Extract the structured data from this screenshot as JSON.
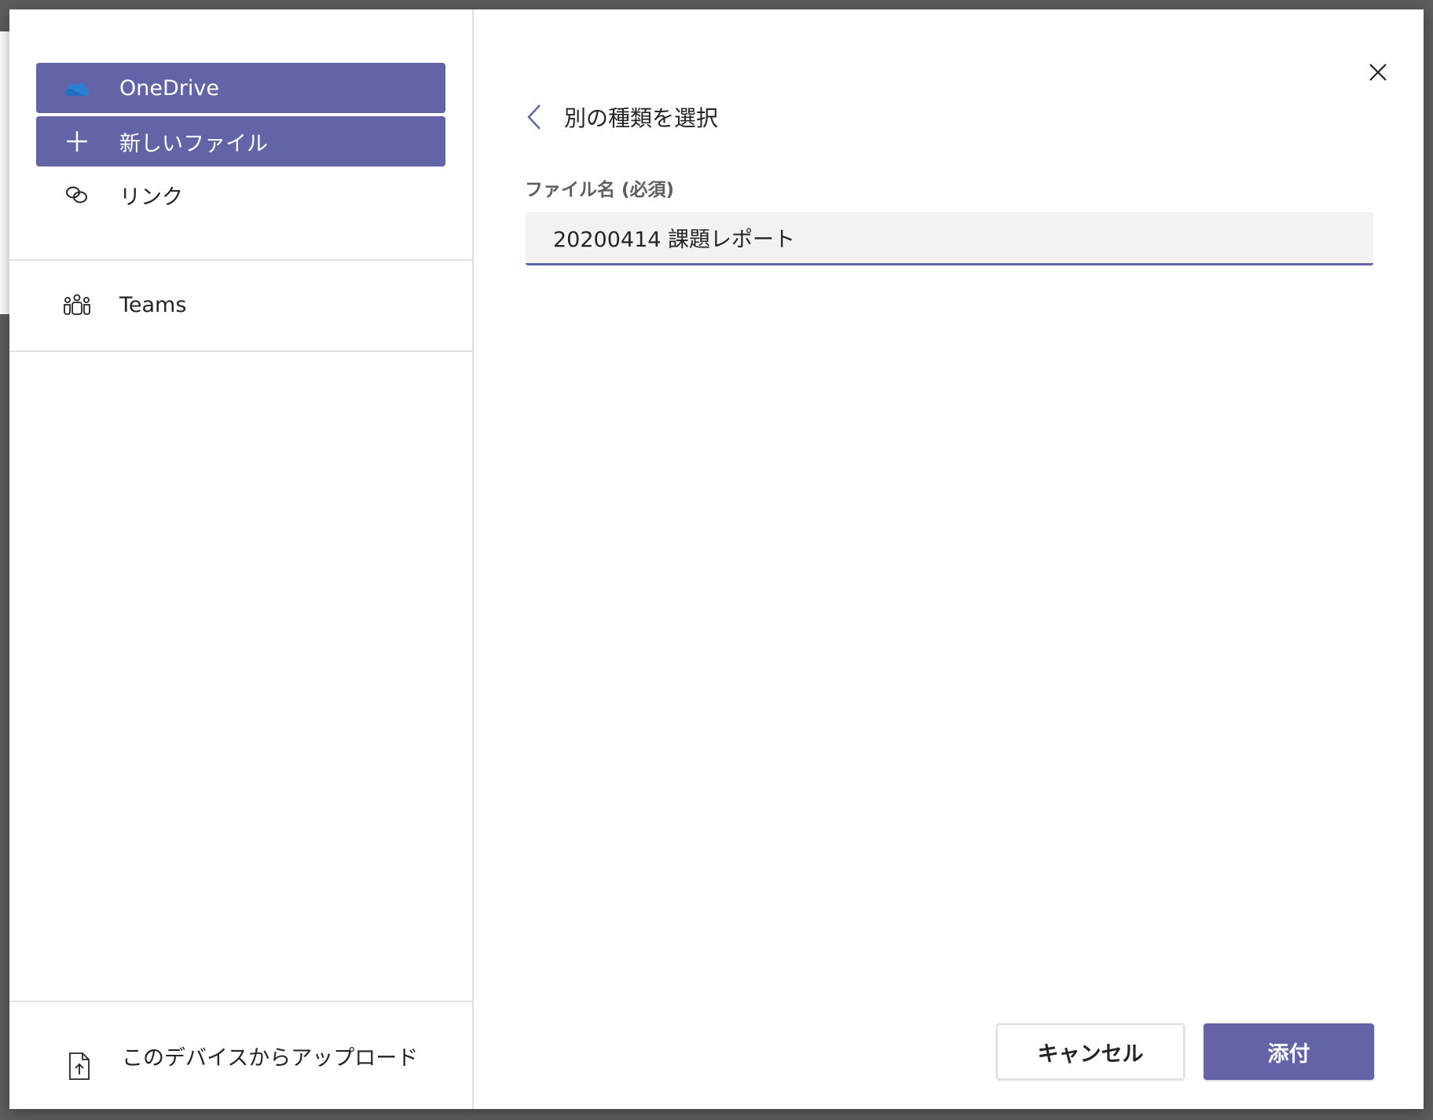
{
  "sidebar": {
    "items": [
      {
        "label": "OneDrive",
        "icon": "onedrive-cloud-icon",
        "selected": true
      },
      {
        "label": "新しいファイル",
        "icon": "plus-icon",
        "selected": true
      },
      {
        "label": "リンク",
        "icon": "link-icon",
        "selected": false
      }
    ],
    "teams": {
      "label": "Teams",
      "icon": "teams-people-icon"
    },
    "upload": {
      "label": "このデバイスからアップロード",
      "icon": "upload-file-icon"
    }
  },
  "main": {
    "back_label": "別の種類を選択",
    "field_label": "ファイル名 (必須)",
    "file_name_value": "20200414 課題レポート",
    "cancel_label": "キャンセル",
    "attach_label": "添付"
  },
  "colors": {
    "accent": "#6264a7",
    "input_bg": "#f3f2f1",
    "text": "#252423",
    "divider": "#e1dfdd",
    "onedrive_blue": "#2a7fd4"
  }
}
